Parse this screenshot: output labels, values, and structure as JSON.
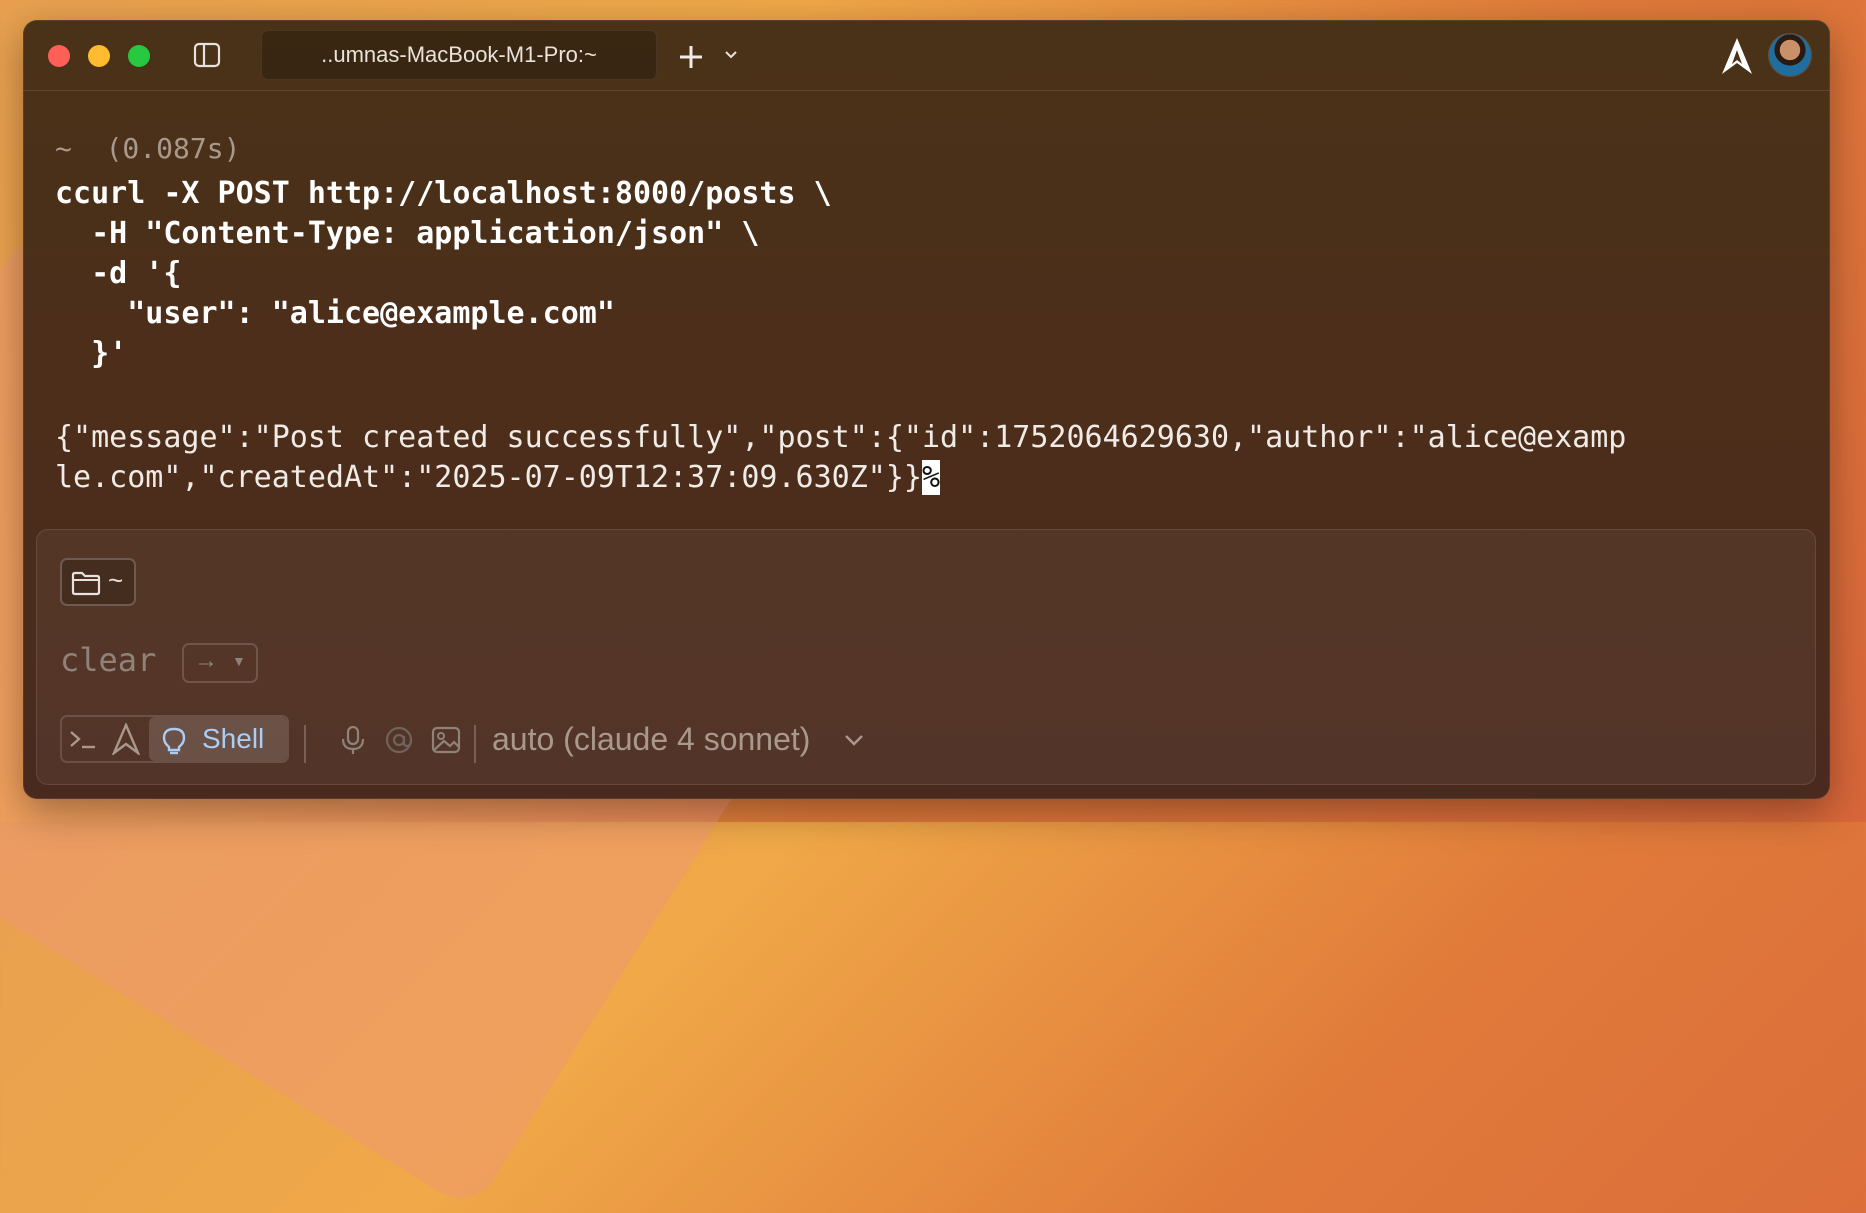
{
  "titlebar": {
    "tab_title": "..umnas-MacBook-M1-Pro:~"
  },
  "terminal": {
    "prompt_dir": "~",
    "duration": "(0.087s)",
    "command_lines": [
      "ccurl -X POST http://localhost:8000/posts \\",
      "  -H \"Content-Type: application/json\" \\",
      "  -d '{",
      "    \"user\": \"alice@example.com\"",
      "  }'"
    ],
    "output_lines": [
      "{\"message\":\"Post created successfully\",\"post\":{\"id\":1752064629630,\"author\":\"alice@examp",
      "le.com\",\"createdAt\":\"2025-07-09T12:37:09.630Z\"}}"
    ],
    "end_marker": "%"
  },
  "input": {
    "cwd": "~",
    "suggestion": "clear",
    "accept_key": "→",
    "mode_label": "Shell",
    "model": "auto (claude 4 sonnet)"
  },
  "colors": {
    "shell_accent": "#a9cdf5",
    "close": "#fe5f57",
    "minimize": "#febc2e",
    "zoom": "#28c840"
  }
}
